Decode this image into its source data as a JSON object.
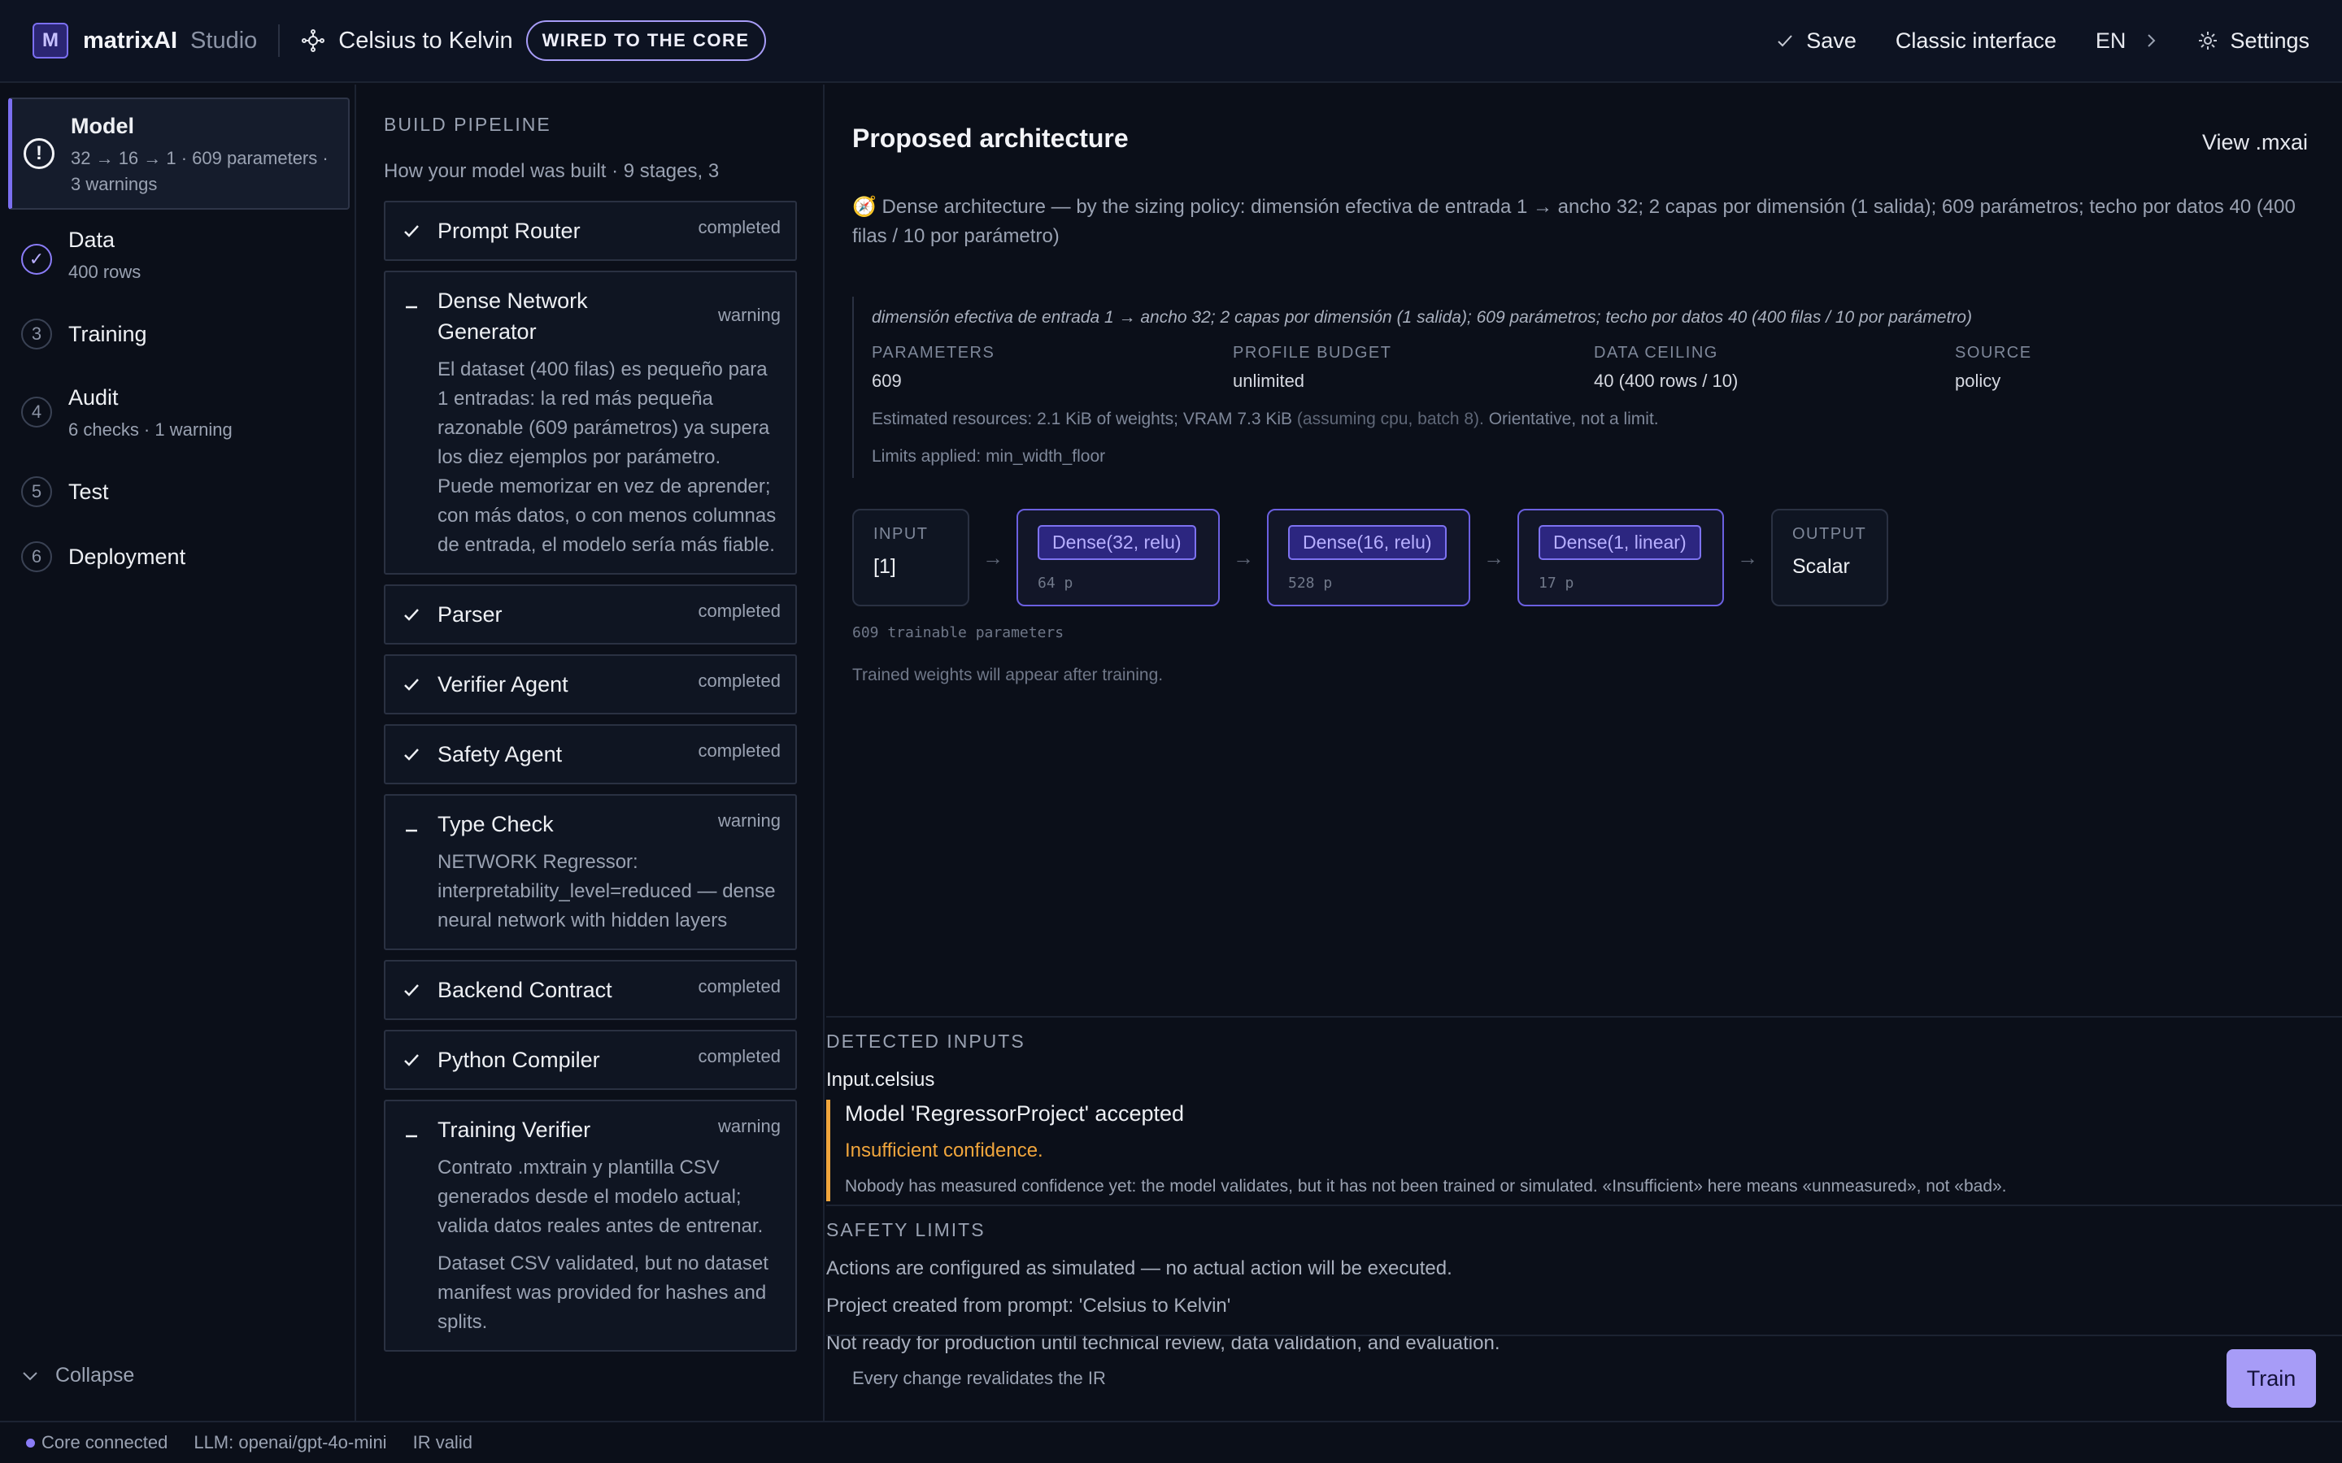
{
  "header": {
    "logo_letter": "M",
    "brand": "matrixAI",
    "studio": "Studio",
    "project_title": "Celsius to Kelvin",
    "tag": "WIRED TO THE CORE",
    "save_label": "Save",
    "classic_label": "Classic interface",
    "lang_label": "EN",
    "settings_label": "Settings"
  },
  "sidebar": {
    "steps": [
      {
        "marker": "!",
        "title": "Model",
        "sub": "32 → 16 → 1 · 609 parameters · 3 warnings"
      },
      {
        "marker": "✓",
        "title": "Data",
        "sub": "400 rows"
      },
      {
        "marker": "3",
        "title": "Training",
        "sub": ""
      },
      {
        "marker": "4",
        "title": "Audit",
        "sub": "6 checks · 1 warning"
      },
      {
        "marker": "5",
        "title": "Test",
        "sub": ""
      },
      {
        "marker": "6",
        "title": "Deployment",
        "sub": ""
      }
    ],
    "collapse_label": "Collapse"
  },
  "pipeline": {
    "label": "BUILD PIPELINE",
    "subtitle": "How your model was built · 9 stages, 3",
    "stages": [
      {
        "name": "Prompt Router",
        "status": "completed",
        "desc": []
      },
      {
        "name": "Dense Network Generator",
        "status": "warning",
        "desc": [
          "El dataset (400 filas) es pequeño para 1 entradas: la red más pequeña razonable (609 parámetros) ya supera los diez ejemplos por parámetro. Puede memorizar en vez de aprender; con más datos, o con menos columnas de entrada, el modelo sería más fiable."
        ]
      },
      {
        "name": "Parser",
        "status": "completed",
        "desc": []
      },
      {
        "name": "Verifier Agent",
        "status": "completed",
        "desc": []
      },
      {
        "name": "Safety Agent",
        "status": "completed",
        "desc": []
      },
      {
        "name": "Type Check",
        "status": "warning",
        "desc": [
          "NETWORK Regressor: interpretability_level=reduced — dense neural network with hidden layers"
        ]
      },
      {
        "name": "Backend Contract",
        "status": "completed",
        "desc": []
      },
      {
        "name": "Python Compiler",
        "status": "completed",
        "desc": []
      },
      {
        "name": "Training Verifier",
        "status": "warning",
        "desc": [
          "Contrato .mxtrain y plantilla CSV generados desde el modelo actual; valida datos reales antes de entrenar.",
          "Dataset CSV validated, but no dataset manifest was provided for hashes and splits."
        ]
      }
    ]
  },
  "architecture": {
    "title": "Proposed architecture",
    "view_label": "View .mxai",
    "icon": "compass-icon",
    "description": "🧭 Dense architecture — by the sizing policy: dimensión efectiva de entrada 1 → ancho 32; 2 capas por dimensión (1 salida); 609 parámetros; techo por datos 40 (400 filas / 10 por parámetro)",
    "italic_note": "dimensión efectiva de entrada 1 → ancho 32; 2 capas por dimensión (1 salida); 609 parámetros; techo por datos 40 (400 filas / 10 por parámetro)",
    "metrics": [
      {
        "label": "PARAMETERS",
        "value": "609"
      },
      {
        "label": "PROFILE BUDGET",
        "value": "unlimited"
      },
      {
        "label": "DATA CEILING",
        "value": "40 (400 rows / 10)"
      },
      {
        "label": "SOURCE",
        "value": "policy"
      }
    ],
    "resources": "Estimated resources: 2.1 KiB of weights; VRAM 7.3 KiB",
    "resources_assumption": "(assuming cpu, batch 8).",
    "resources_tail": "Orientative, not a limit.",
    "limits": "Limits applied: min_width_floor",
    "input": {
      "label": "INPUT",
      "value": "[1]"
    },
    "layers": [
      {
        "name": "Dense(32, relu)",
        "params": "64 p"
      },
      {
        "name": "Dense(16, relu)",
        "params": "528 p"
      },
      {
        "name": "Dense(1, linear)",
        "params": "17 p"
      }
    ],
    "output": {
      "label": "OUTPUT",
      "value": "Scalar"
    },
    "arrow": "→",
    "trainable": "609 trainable parameters",
    "trained_note": "Trained weights will appear after training."
  },
  "detected": {
    "label": "DETECTED INPUTS",
    "input": "Input.celsius",
    "accepted": "Model 'RegressorProject' accepted",
    "warning": "Insufficient confidence.",
    "note": "Nobody has measured confidence yet: the model validates, but it has not been trained or simulated. «Insufficient» here means «unmeasured», not «bad»."
  },
  "safety": {
    "label": "SAFETY LIMITS",
    "lines": [
      "Actions are configured as simulated — no actual action will be executed.",
      "Project created from prompt: 'Celsius to Kelvin'",
      "Not ready for production until technical review, data validation, and evaluation."
    ]
  },
  "footer": {
    "note": "Every change revalidates the IR",
    "train_label": "Train"
  },
  "statusbar": {
    "core": "Core connected",
    "llm": "LLM: openai/gpt-4o-mini",
    "ir": "IR valid"
  },
  "colors": {
    "accent": "#a79cf7",
    "warning": "#f0a53c",
    "background": "#0b0f19"
  }
}
